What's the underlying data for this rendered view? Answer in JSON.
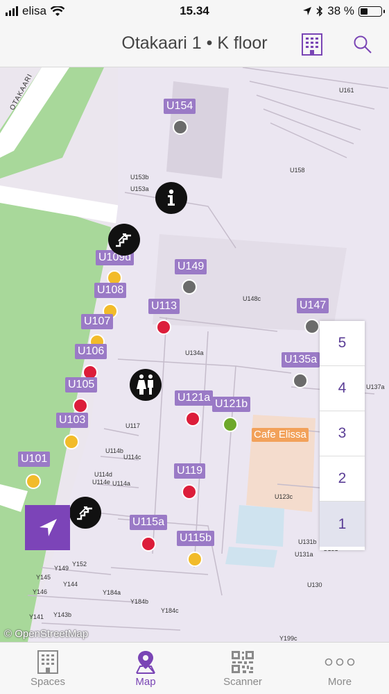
{
  "status_bar": {
    "carrier": "elisa",
    "time": "15.34",
    "battery": "38 %",
    "battery_level": 0.38
  },
  "header": {
    "title": "Otakaari 1 • K floor",
    "building_icon": "building-grid-icon",
    "search_icon": "search-icon"
  },
  "map": {
    "attribution": "© OpenStreetMap",
    "cafe": "Cafe Elissa",
    "spaces": [
      {
        "id": "u154",
        "label": "U154",
        "status": "gray"
      },
      {
        "id": "u109d",
        "label": "U109d",
        "status": "yellow"
      },
      {
        "id": "u149",
        "label": "U149",
        "status": "gray"
      },
      {
        "id": "u108",
        "label": "U108",
        "status": "yellow"
      },
      {
        "id": "u113",
        "label": "U113",
        "status": "red"
      },
      {
        "id": "u147",
        "label": "U147",
        "status": "gray"
      },
      {
        "id": "u107",
        "label": "U107",
        "status": "yellow"
      },
      {
        "id": "u106",
        "label": "U106",
        "status": "red"
      },
      {
        "id": "u135a",
        "label": "U135a",
        "status": "gray"
      },
      {
        "id": "u105",
        "label": "U105",
        "status": "red"
      },
      {
        "id": "u121a",
        "label": "U121a",
        "status": "red"
      },
      {
        "id": "u121b",
        "label": "U121b",
        "status": "green"
      },
      {
        "id": "u103",
        "label": "U103",
        "status": "yellow"
      },
      {
        "id": "u101",
        "label": "U101",
        "status": "yellow"
      },
      {
        "id": "u119",
        "label": "U119",
        "status": "red"
      },
      {
        "id": "u115a",
        "label": "U115a",
        "status": "red"
      },
      {
        "id": "u115b",
        "label": "U115b",
        "status": "yellow"
      }
    ],
    "room_labels": [
      "U161",
      "U158",
      "U153b",
      "U153a",
      "U148c",
      "U134a",
      "U117",
      "U114b",
      "U114c",
      "U114d",
      "U114e",
      "U114a",
      "U137a",
      "U123c",
      "U131b",
      "U131a",
      "U131",
      "U130",
      "Y152",
      "Y149",
      "Y145",
      "Y144",
      "Y146",
      "Y184a",
      "Y184b",
      "Y184c",
      "Y141",
      "Y143b",
      "Y199c"
    ],
    "street": "OTAKAARI"
  },
  "colors": {
    "red": "#dc1d3a",
    "yellow": "#f2bb2a",
    "gray": "#6b6b6b",
    "green": "#6ea82a",
    "accent": "#7a45b5",
    "label_bg": "#9a7ac6"
  },
  "floors": [
    "5",
    "4",
    "3",
    "2",
    "1"
  ],
  "selected_floor": "1",
  "tabs": [
    {
      "label": "Spaces",
      "icon": "building-icon"
    },
    {
      "label": "Map",
      "icon": "map-pin-icon",
      "active": true
    },
    {
      "label": "Scanner",
      "icon": "qr-code-icon"
    },
    {
      "label": "More",
      "icon": "more-dots-icon"
    }
  ]
}
